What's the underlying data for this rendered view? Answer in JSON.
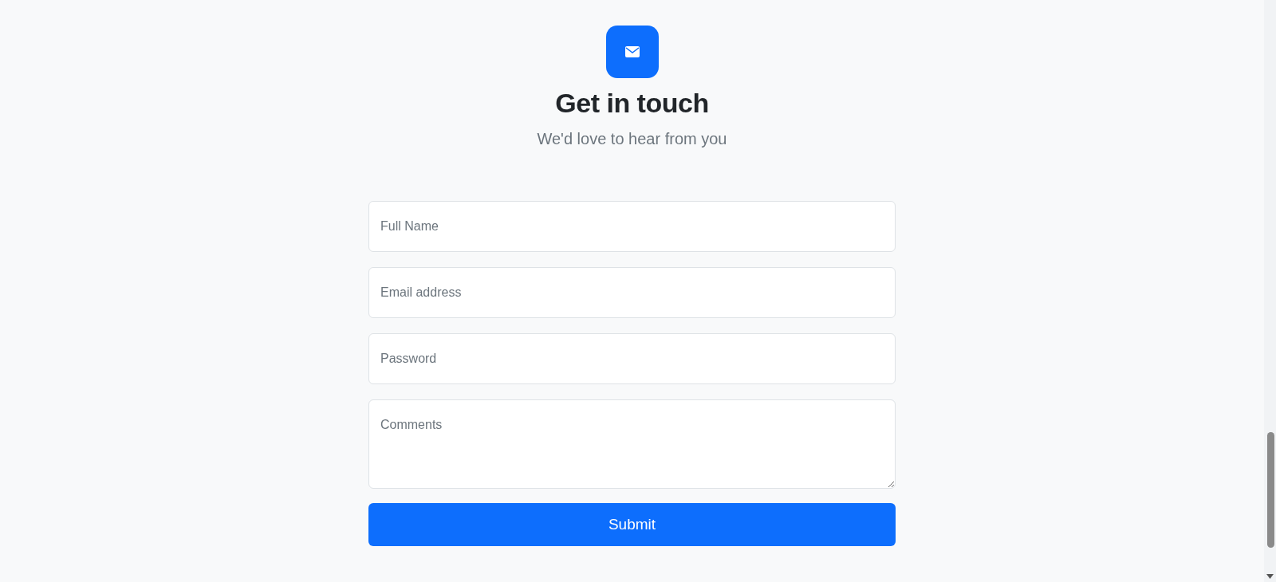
{
  "header": {
    "title": "Get in touch",
    "subtitle": "We'd love to hear from you"
  },
  "form": {
    "fields": [
      {
        "kind": "input",
        "placeholder": "Full Name"
      },
      {
        "kind": "input",
        "placeholder": "Email address"
      },
      {
        "kind": "password",
        "placeholder": "Password"
      },
      {
        "kind": "textarea",
        "placeholder": "Comments"
      }
    ],
    "submit": "Submit"
  }
}
